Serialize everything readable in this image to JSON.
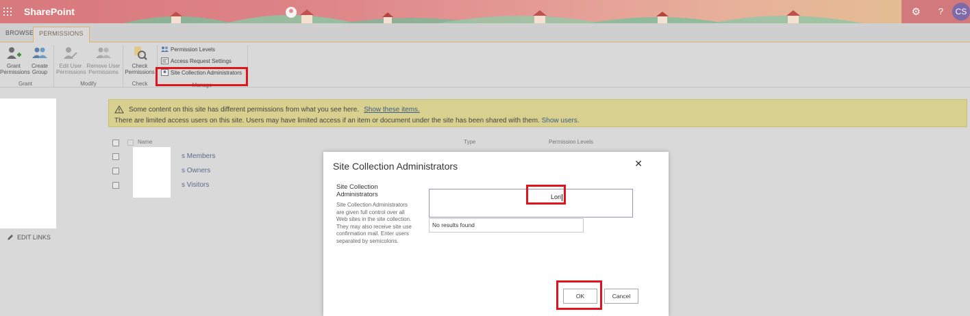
{
  "suitebar": {
    "app_name": "SharePoint",
    "user_initials": "CS",
    "settings_glyph": "⚙",
    "help_glyph": "?"
  },
  "ribbon": {
    "tabs": [
      {
        "label": "BROWSE"
      },
      {
        "label": "PERMISSIONS"
      }
    ],
    "buttons": {
      "grant_permissions": "Grant\nPermissions",
      "create_group": "Create\nGroup",
      "edit_user_permissions": "Edit User\nPermissions",
      "remove_user_permissions": "Remove User\nPermissions",
      "check_permissions": "Check\nPermissions"
    },
    "small_buttons": {
      "permission_levels": "Permission Levels",
      "access_request_settings": "Access Request Settings",
      "site_collection_administrators": "Site Collection Administrators"
    },
    "groups": {
      "grant": "Grant",
      "modify": "Modify",
      "check": "Check",
      "manage": "Manage"
    }
  },
  "leftnav": {
    "edit_links": "EDIT LINKS"
  },
  "banner": {
    "line1_text": "Some content on this site has different permissions from what you see here.",
    "line1_link": "Show these items.",
    "line2_text": "There are limited access users on this site. Users may have limited access if an item or document under the site has been shared with them.",
    "line2_link": "Show users."
  },
  "permissions_list": {
    "headers": {
      "name": "Name",
      "type": "Type",
      "permission_levels": "Permission Levels"
    },
    "rows": [
      {
        "name": "s Members"
      },
      {
        "name": "s Owners"
      },
      {
        "name": "s Visitors"
      }
    ]
  },
  "dialog": {
    "title": "Site Collection Administrators",
    "close_glyph": "✕",
    "field_label": "Site Collection Administrators",
    "field_description": "Site Collection Administrators are given full control over all Web sites in the site collection. They may also receive site use confirmation mail. Enter users separated by semicolons.",
    "picker_value": "Lori",
    "results_text": "No results found",
    "ok_label": "OK",
    "cancel_label": "Cancel"
  },
  "colors": {
    "highlight_red": "#e0141d",
    "banner_yellow": "#d8d08e",
    "accent_orange": "#e0b16e",
    "link_blue": "#3b5c8a"
  }
}
